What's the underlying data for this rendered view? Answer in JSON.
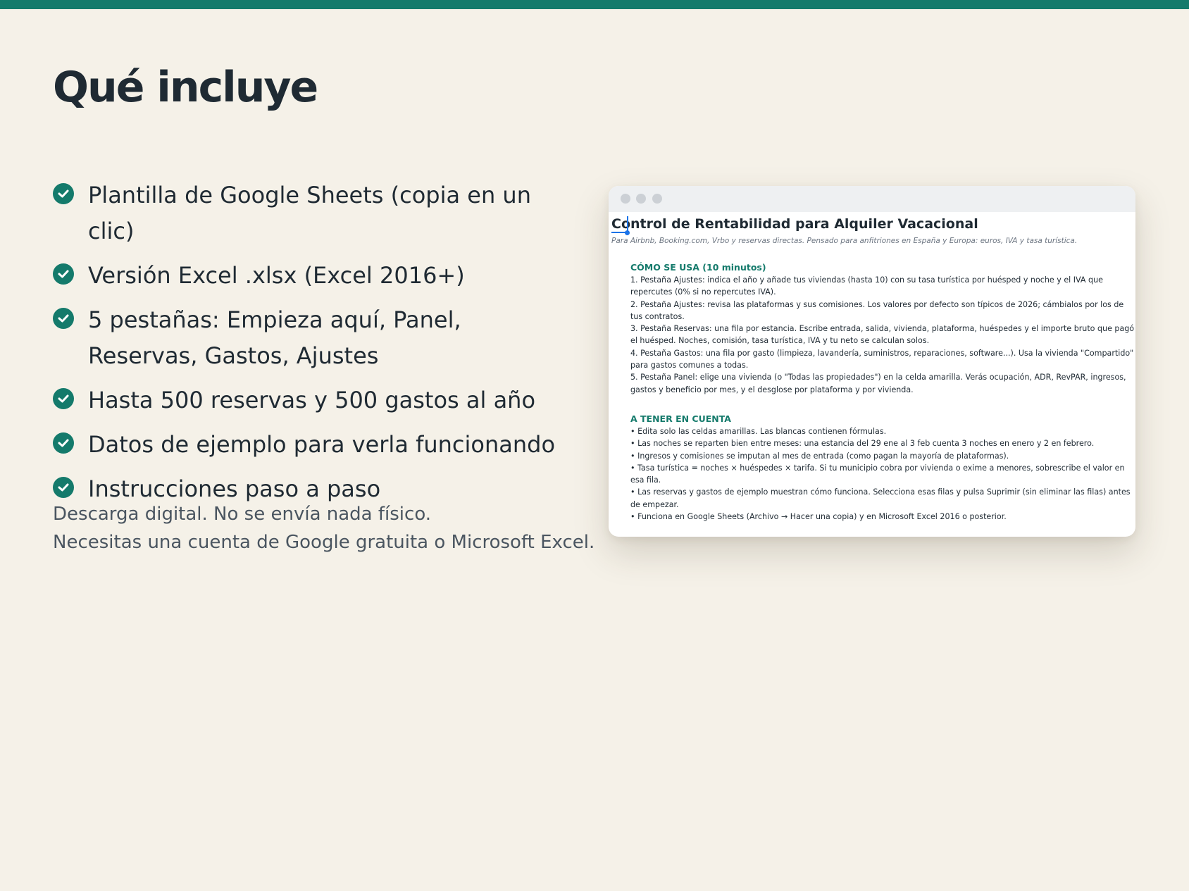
{
  "page": {
    "title": "Qué incluye",
    "features": [
      "Plantilla de Google Sheets (copia en un clic)",
      "Versión Excel .xlsx (Excel 2016+)",
      "5 pestañas: Empieza aquí, Panel, Reservas, Gastos, Ajustes",
      "Hasta 500 reservas y 500 gastos al año",
      "Datos de ejemplo para verla funcionando",
      "Instrucciones paso a paso"
    ],
    "note_lines": [
      "Descarga digital. No se envía nada físico.",
      "Necesitas una cuenta de Google gratuita o Microsoft Excel."
    ]
  },
  "preview": {
    "title": "Control de Rentabilidad para Alquiler Vacacional",
    "subtitle": "Para Airbnb, Booking.com, Vrbo y reservas directas. Pensado para anfitriones en España y Europa: euros, IVA y tasa turística.",
    "how_to": {
      "heading": "CÓMO SE USA (10 minutos)",
      "lines": [
        "1. Pestaña Ajustes: indica el año y añade tus viviendas (hasta 10) con su tasa turística por huésped y noche y el IVA que repercutes (0% si no repercutes IVA).",
        "2. Pestaña Ajustes: revisa las plataformas y sus comisiones. Los valores por defecto son típicos de 2026; cámbialos por los de tus contratos.",
        "3. Pestaña Reservas: una fila por estancia. Escribe entrada, salida, vivienda, plataforma, huéspedes y el importe bruto que pagó el huésped. Noches, comisión, tasa turística, IVA y tu neto se calculan solos.",
        "4. Pestaña Gastos: una fila por gasto (limpieza, lavandería, suministros, reparaciones, software...). Usa la vivienda \"Compartido\" para gastos comunes a todas.",
        "5. Pestaña Panel: elige una vivienda (o \"Todas las propiedades\") en la celda amarilla. Verás ocupación, ADR, RevPAR, ingresos, gastos y beneficio por mes, y el desglose por plataforma y por vivienda."
      ]
    },
    "notes": {
      "heading": "A TENER EN CUENTA",
      "lines": [
        "• Edita solo las celdas amarillas. Las blancas contienen fórmulas.",
        "• Las noches se reparten bien entre meses: una estancia del 29 ene al 3 feb cuenta 3 noches en enero y 2 en febrero.",
        "• Ingresos y comisiones se imputan al mes de entrada (como pagan la mayoría de plataformas).",
        "• Tasa turística = noches × huéspedes × tarifa. Si tu municipio cobra por vivienda o exime a menores, sobrescribe el valor en esa fila.",
        "• Las reservas y gastos de ejemplo muestran cómo funciona. Selecciona esas filas y pulsa Suprimir (sin eliminar las filas) antes de empezar.",
        "• Funciona en Google Sheets (Archivo → Hacer una copia) y en Microsoft Excel 2016 o posterior."
      ]
    }
  },
  "colors": {
    "accent": "#147a6b",
    "background": "#f5f1e8",
    "text": "#1f2a33",
    "muted": "#4a5560"
  },
  "icons": {
    "feature_bullet": "check-circle-icon",
    "window_controls": "window-dot"
  }
}
